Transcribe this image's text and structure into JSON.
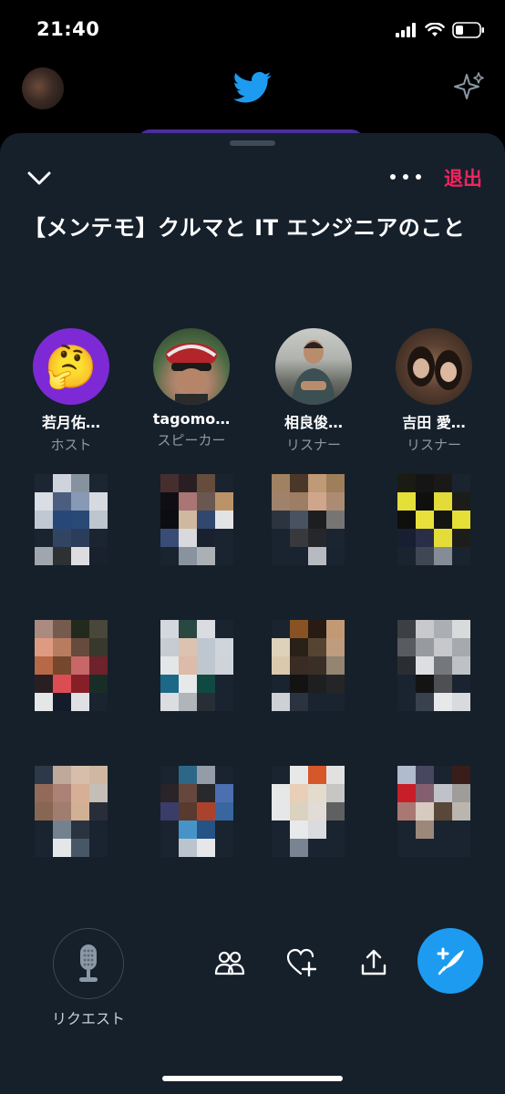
{
  "status_bar": {
    "time": "21:40",
    "icons": [
      "cellular-signal-icon",
      "wifi-icon",
      "battery-icon"
    ]
  },
  "background": {
    "logo": "twitter-bird-icon",
    "sparkle": "sparkle-icon"
  },
  "header": {
    "leave_label": "退出",
    "title": "【メンテモ】クルマと IT エンジニアのこと"
  },
  "participants": [
    {
      "name": "若月佑…",
      "role": "ホスト",
      "avatar": "thinking-face-emoji",
      "emoji": "🤔"
    },
    {
      "name": "tagomo…",
      "role": "スピーカー",
      "avatar": "cyclist-photo"
    },
    {
      "name": "相良俊…",
      "role": "リスナー",
      "avatar": "man-photo"
    },
    {
      "name": "吉田 愛…",
      "role": "リスナー",
      "avatar": "women-photo"
    }
  ],
  "blurred_listeners_visible": 12,
  "bottom_bar": {
    "mic_label": "リクエスト",
    "tools": [
      "people-icon",
      "heart-plus-icon",
      "share-icon"
    ],
    "fab": "compose-tweet-icon"
  },
  "colors": {
    "sheet_bg": "#15202b",
    "accent_blue": "#1d9bf0",
    "leave_red": "#f4245e",
    "muted": "#8b98a5"
  }
}
